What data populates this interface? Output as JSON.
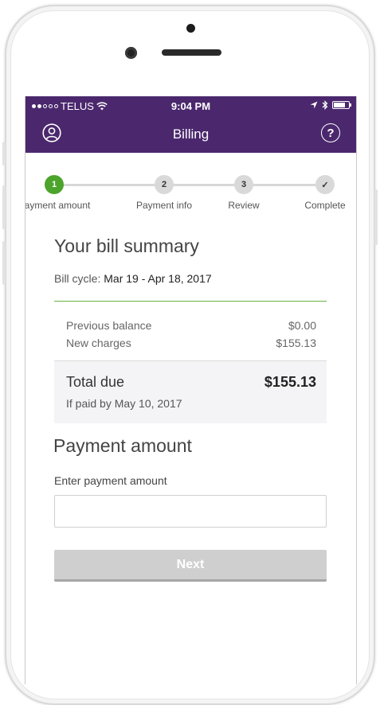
{
  "status_bar": {
    "carrier": "TELUS",
    "time": "9:04 PM"
  },
  "header": {
    "title": "Billing",
    "left_icon": "user-profile-icon",
    "right_icon": "help-icon",
    "background_color": "#4b286d"
  },
  "stepper": {
    "steps": [
      {
        "number": "1",
        "label": "Payment amount",
        "state": "active"
      },
      {
        "number": "2",
        "label": "Payment info",
        "state": "pending"
      },
      {
        "number": "3",
        "label": "Review",
        "state": "pending"
      },
      {
        "number": "✓",
        "label": "Complete",
        "state": "pending"
      }
    ],
    "active_color": "#4ca42c"
  },
  "summary": {
    "title": "Your bill summary",
    "cycle_label": "Bill cycle:",
    "cycle_value": "Mar 19 - Apr 18, 2017",
    "lines": [
      {
        "label": "Previous balance",
        "value": "$0.00"
      },
      {
        "label": "New charges",
        "value": "$155.13"
      }
    ],
    "total_label": "Total due",
    "total_value": "$155.13",
    "due_note": "If paid by May 10, 2017"
  },
  "payment": {
    "title": "Payment amount",
    "input_label": "Enter payment amount",
    "input_value": "",
    "next_label": "Next"
  }
}
